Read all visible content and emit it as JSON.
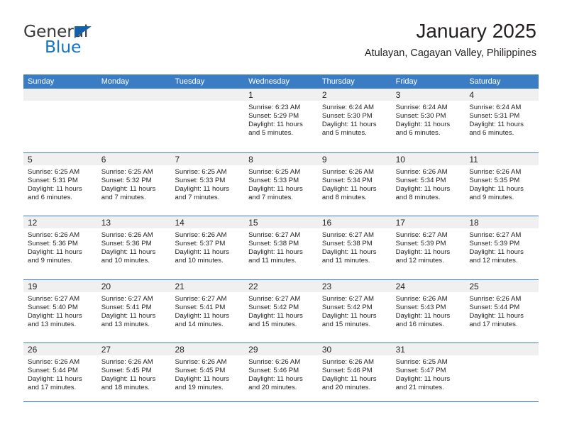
{
  "brand": {
    "name_top": "General",
    "name_bottom": "Blue",
    "triangle_color": "#1060aa",
    "blue_color": "#1275c6",
    "gray_color": "#3b3b3d"
  },
  "header": {
    "title": "January 2025",
    "subtitle": "Atulayan, Cagayan Valley, Philippines"
  },
  "theme": {
    "header_blue": "#3b7dc4",
    "band_gray": "#f0f0f0",
    "text": "#231f20"
  },
  "weekdays": [
    "Sunday",
    "Monday",
    "Tuesday",
    "Wednesday",
    "Thursday",
    "Friday",
    "Saturday"
  ],
  "weeks": [
    [
      {
        "day": "",
        "empty": true
      },
      {
        "day": "",
        "empty": true
      },
      {
        "day": "",
        "empty": true
      },
      {
        "day": "1",
        "sunrise": "Sunrise: 6:23 AM",
        "sunset": "Sunset: 5:29 PM",
        "daylight_line1": "Daylight: 11 hours",
        "daylight_line2": "and 5 minutes."
      },
      {
        "day": "2",
        "sunrise": "Sunrise: 6:24 AM",
        "sunset": "Sunset: 5:30 PM",
        "daylight_line1": "Daylight: 11 hours",
        "daylight_line2": "and 5 minutes."
      },
      {
        "day": "3",
        "sunrise": "Sunrise: 6:24 AM",
        "sunset": "Sunset: 5:30 PM",
        "daylight_line1": "Daylight: 11 hours",
        "daylight_line2": "and 6 minutes."
      },
      {
        "day": "4",
        "sunrise": "Sunrise: 6:24 AM",
        "sunset": "Sunset: 5:31 PM",
        "daylight_line1": "Daylight: 11 hours",
        "daylight_line2": "and 6 minutes."
      }
    ],
    [
      {
        "day": "5",
        "sunrise": "Sunrise: 6:25 AM",
        "sunset": "Sunset: 5:31 PM",
        "daylight_line1": "Daylight: 11 hours",
        "daylight_line2": "and 6 minutes."
      },
      {
        "day": "6",
        "sunrise": "Sunrise: 6:25 AM",
        "sunset": "Sunset: 5:32 PM",
        "daylight_line1": "Daylight: 11 hours",
        "daylight_line2": "and 7 minutes."
      },
      {
        "day": "7",
        "sunrise": "Sunrise: 6:25 AM",
        "sunset": "Sunset: 5:33 PM",
        "daylight_line1": "Daylight: 11 hours",
        "daylight_line2": "and 7 minutes."
      },
      {
        "day": "8",
        "sunrise": "Sunrise: 6:25 AM",
        "sunset": "Sunset: 5:33 PM",
        "daylight_line1": "Daylight: 11 hours",
        "daylight_line2": "and 7 minutes."
      },
      {
        "day": "9",
        "sunrise": "Sunrise: 6:26 AM",
        "sunset": "Sunset: 5:34 PM",
        "daylight_line1": "Daylight: 11 hours",
        "daylight_line2": "and 8 minutes."
      },
      {
        "day": "10",
        "sunrise": "Sunrise: 6:26 AM",
        "sunset": "Sunset: 5:34 PM",
        "daylight_line1": "Daylight: 11 hours",
        "daylight_line2": "and 8 minutes."
      },
      {
        "day": "11",
        "sunrise": "Sunrise: 6:26 AM",
        "sunset": "Sunset: 5:35 PM",
        "daylight_line1": "Daylight: 11 hours",
        "daylight_line2": "and 9 minutes."
      }
    ],
    [
      {
        "day": "12",
        "sunrise": "Sunrise: 6:26 AM",
        "sunset": "Sunset: 5:36 PM",
        "daylight_line1": "Daylight: 11 hours",
        "daylight_line2": "and 9 minutes."
      },
      {
        "day": "13",
        "sunrise": "Sunrise: 6:26 AM",
        "sunset": "Sunset: 5:36 PM",
        "daylight_line1": "Daylight: 11 hours",
        "daylight_line2": "and 10 minutes."
      },
      {
        "day": "14",
        "sunrise": "Sunrise: 6:26 AM",
        "sunset": "Sunset: 5:37 PM",
        "daylight_line1": "Daylight: 11 hours",
        "daylight_line2": "and 10 minutes."
      },
      {
        "day": "15",
        "sunrise": "Sunrise: 6:27 AM",
        "sunset": "Sunset: 5:38 PM",
        "daylight_line1": "Daylight: 11 hours",
        "daylight_line2": "and 11 minutes."
      },
      {
        "day": "16",
        "sunrise": "Sunrise: 6:27 AM",
        "sunset": "Sunset: 5:38 PM",
        "daylight_line1": "Daylight: 11 hours",
        "daylight_line2": "and 11 minutes."
      },
      {
        "day": "17",
        "sunrise": "Sunrise: 6:27 AM",
        "sunset": "Sunset: 5:39 PM",
        "daylight_line1": "Daylight: 11 hours",
        "daylight_line2": "and 12 minutes."
      },
      {
        "day": "18",
        "sunrise": "Sunrise: 6:27 AM",
        "sunset": "Sunset: 5:39 PM",
        "daylight_line1": "Daylight: 11 hours",
        "daylight_line2": "and 12 minutes."
      }
    ],
    [
      {
        "day": "19",
        "sunrise": "Sunrise: 6:27 AM",
        "sunset": "Sunset: 5:40 PM",
        "daylight_line1": "Daylight: 11 hours",
        "daylight_line2": "and 13 minutes."
      },
      {
        "day": "20",
        "sunrise": "Sunrise: 6:27 AM",
        "sunset": "Sunset: 5:41 PM",
        "daylight_line1": "Daylight: 11 hours",
        "daylight_line2": "and 13 minutes."
      },
      {
        "day": "21",
        "sunrise": "Sunrise: 6:27 AM",
        "sunset": "Sunset: 5:41 PM",
        "daylight_line1": "Daylight: 11 hours",
        "daylight_line2": "and 14 minutes."
      },
      {
        "day": "22",
        "sunrise": "Sunrise: 6:27 AM",
        "sunset": "Sunset: 5:42 PM",
        "daylight_line1": "Daylight: 11 hours",
        "daylight_line2": "and 15 minutes."
      },
      {
        "day": "23",
        "sunrise": "Sunrise: 6:27 AM",
        "sunset": "Sunset: 5:42 PM",
        "daylight_line1": "Daylight: 11 hours",
        "daylight_line2": "and 15 minutes."
      },
      {
        "day": "24",
        "sunrise": "Sunrise: 6:26 AM",
        "sunset": "Sunset: 5:43 PM",
        "daylight_line1": "Daylight: 11 hours",
        "daylight_line2": "and 16 minutes."
      },
      {
        "day": "25",
        "sunrise": "Sunrise: 6:26 AM",
        "sunset": "Sunset: 5:44 PM",
        "daylight_line1": "Daylight: 11 hours",
        "daylight_line2": "and 17 minutes."
      }
    ],
    [
      {
        "day": "26",
        "sunrise": "Sunrise: 6:26 AM",
        "sunset": "Sunset: 5:44 PM",
        "daylight_line1": "Daylight: 11 hours",
        "daylight_line2": "and 17 minutes."
      },
      {
        "day": "27",
        "sunrise": "Sunrise: 6:26 AM",
        "sunset": "Sunset: 5:45 PM",
        "daylight_line1": "Daylight: 11 hours",
        "daylight_line2": "and 18 minutes."
      },
      {
        "day": "28",
        "sunrise": "Sunrise: 6:26 AM",
        "sunset": "Sunset: 5:45 PM",
        "daylight_line1": "Daylight: 11 hours",
        "daylight_line2": "and 19 minutes."
      },
      {
        "day": "29",
        "sunrise": "Sunrise: 6:26 AM",
        "sunset": "Sunset: 5:46 PM",
        "daylight_line1": "Daylight: 11 hours",
        "daylight_line2": "and 20 minutes."
      },
      {
        "day": "30",
        "sunrise": "Sunrise: 6:26 AM",
        "sunset": "Sunset: 5:46 PM",
        "daylight_line1": "Daylight: 11 hours",
        "daylight_line2": "and 20 minutes."
      },
      {
        "day": "31",
        "sunrise": "Sunrise: 6:25 AM",
        "sunset": "Sunset: 5:47 PM",
        "daylight_line1": "Daylight: 11 hours",
        "daylight_line2": "and 21 minutes."
      },
      {
        "day": "",
        "empty": true
      }
    ]
  ]
}
